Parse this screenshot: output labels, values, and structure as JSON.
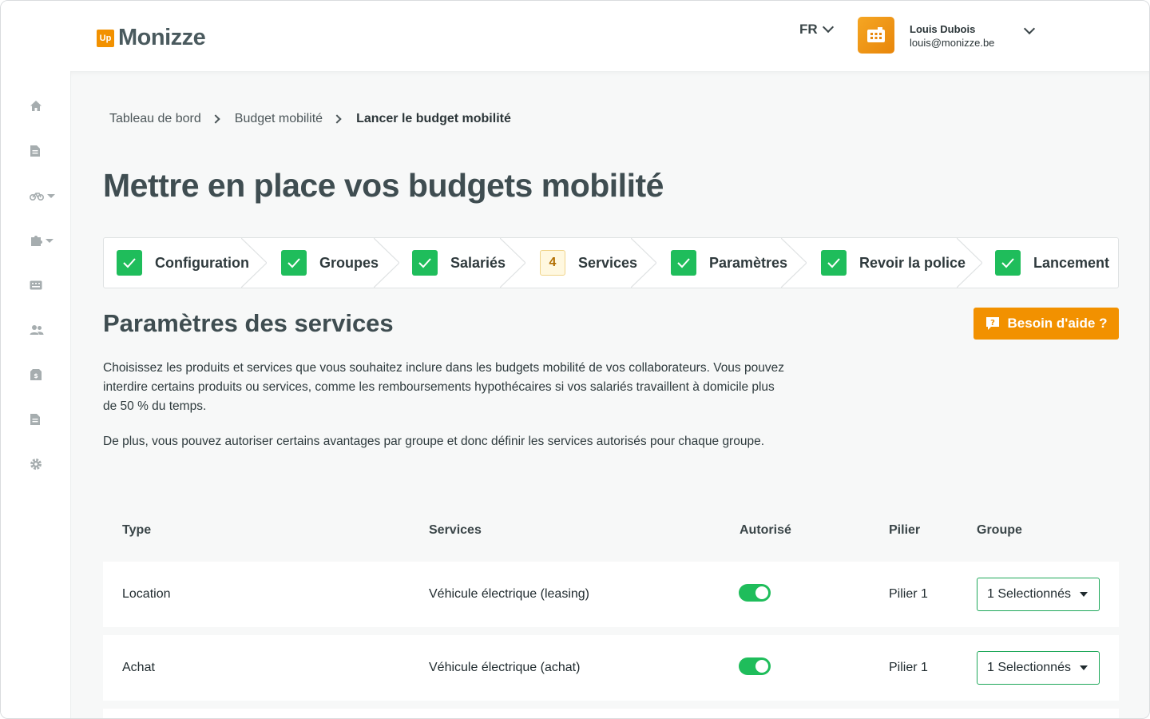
{
  "header": {
    "logo_badge": "Up",
    "logo_text": "Monizze",
    "language": "FR",
    "user_name": "Louis Dubois",
    "user_email": "louis@monizze.be"
  },
  "sidebar": {
    "items": [
      "home-icon",
      "document-icon",
      "bike-icon",
      "puzzle-icon",
      "keyboard-icon",
      "users-icon",
      "money-icon",
      "file-icon",
      "gear-icon"
    ]
  },
  "breadcrumb": [
    "Tableau de bord",
    "Budget mobilité",
    "Lancer le budget mobilité"
  ],
  "page_title": "Mettre en place vos budgets mobilité",
  "stepper": {
    "steps": [
      {
        "label": "Configuration",
        "state": "done"
      },
      {
        "label": "Groupes",
        "state": "done"
      },
      {
        "label": "Salariés",
        "state": "done"
      },
      {
        "label": "Services",
        "state": "current",
        "number": "4"
      },
      {
        "label": "Paramètres",
        "state": "done"
      },
      {
        "label": "Revoir la police",
        "state": "done"
      },
      {
        "label": "Lancement",
        "state": "done"
      }
    ]
  },
  "section": {
    "title": "Paramètres des services",
    "help_button": "Besoin d'aide ?",
    "paragraph_1": "Choisissez les produits et services que vous souhaitez inclure dans les budgets mobilité de vos collaborateurs. Vous pouvez interdire certains produits ou services, comme les remboursements hypothécaires si vos salariés travaillent à domicile plus de 50 % du temps.",
    "paragraph_2": "De plus, vous pouvez autoriser certains avantages par groupe et donc définir les services autorisés pour chaque groupe."
  },
  "table": {
    "headers": [
      "Type",
      "Services",
      "Autorisé",
      "Pilier",
      "Groupe"
    ],
    "rows": [
      {
        "type": "Location",
        "service": "Véhicule électrique (leasing)",
        "authorized": true,
        "pillar": "Pilier 1",
        "group": "1 Selectionnés"
      },
      {
        "type": "Achat",
        "service": "Véhicule électrique (achat)",
        "authorized": true,
        "pillar": "Pilier 1",
        "group": "1 Selectionnés"
      }
    ]
  },
  "colors": {
    "accent": "#f29100",
    "success": "#1fbd5b",
    "title": "#3f4d51"
  }
}
